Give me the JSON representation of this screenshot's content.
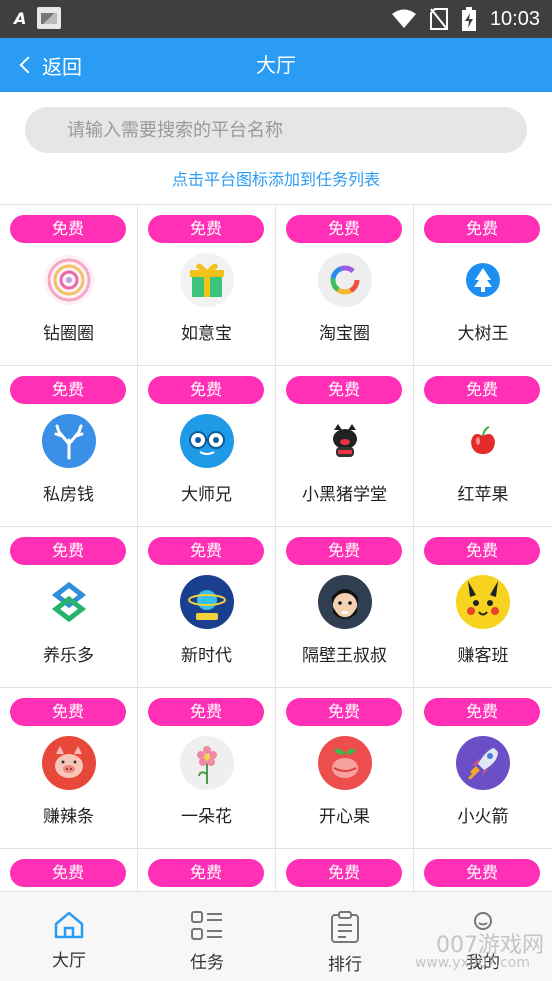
{
  "statusbar": {
    "time": "10:03",
    "left_glyph": "A"
  },
  "header": {
    "back_label": "返回",
    "title": "大厅"
  },
  "search": {
    "placeholder": "请输入需要搜索的平台名称"
  },
  "hint": "点击平台图标添加到任务列表",
  "badge_label": "免费",
  "platforms": [
    {
      "name": "钻圈圈",
      "icon": "spiral-icon"
    },
    {
      "name": "如意宝",
      "icon": "gift-box-icon"
    },
    {
      "name": "淘宝圈",
      "icon": "rainbow-ring-icon"
    },
    {
      "name": "大树王",
      "icon": "tree-icon"
    },
    {
      "name": "私房钱",
      "icon": "antler-icon"
    },
    {
      "name": "大师兄",
      "icon": "glasses-face-icon"
    },
    {
      "name": "小黑猪学堂",
      "icon": "black-pig-icon"
    },
    {
      "name": "红苹果",
      "icon": "red-apple-icon"
    },
    {
      "name": "养乐多",
      "icon": "knot-icon"
    },
    {
      "name": "新时代",
      "icon": "planet-icon"
    },
    {
      "name": "隔壁王叔叔",
      "icon": "bearded-man-icon"
    },
    {
      "name": "赚客班",
      "icon": "pikachu-icon"
    },
    {
      "name": "赚辣条",
      "icon": "pig-face-icon"
    },
    {
      "name": "一朵花",
      "icon": "flower-icon"
    },
    {
      "name": "开心果",
      "icon": "fruit-icon"
    },
    {
      "name": "小火箭",
      "icon": "rocket-icon"
    },
    {
      "name": "",
      "icon": ""
    },
    {
      "name": "",
      "icon": ""
    },
    {
      "name": "",
      "icon": ""
    },
    {
      "name": "",
      "icon": ""
    }
  ],
  "bottomnav": [
    {
      "label": "大厅",
      "icon": "home-icon",
      "active": true
    },
    {
      "label": "任务",
      "icon": "task-list-icon",
      "active": false
    },
    {
      "label": "排行",
      "icon": "ranking-clipboard-icon",
      "active": false
    },
    {
      "label": "我的",
      "icon": "profile-icon",
      "active": false
    }
  ],
  "watermark": {
    "line1": "007游戏网",
    "line2": "www.yx007.com"
  },
  "colors": {
    "header": "#2a9cf3",
    "badge": "#ff2fb6",
    "hint": "#2a9cf3"
  }
}
